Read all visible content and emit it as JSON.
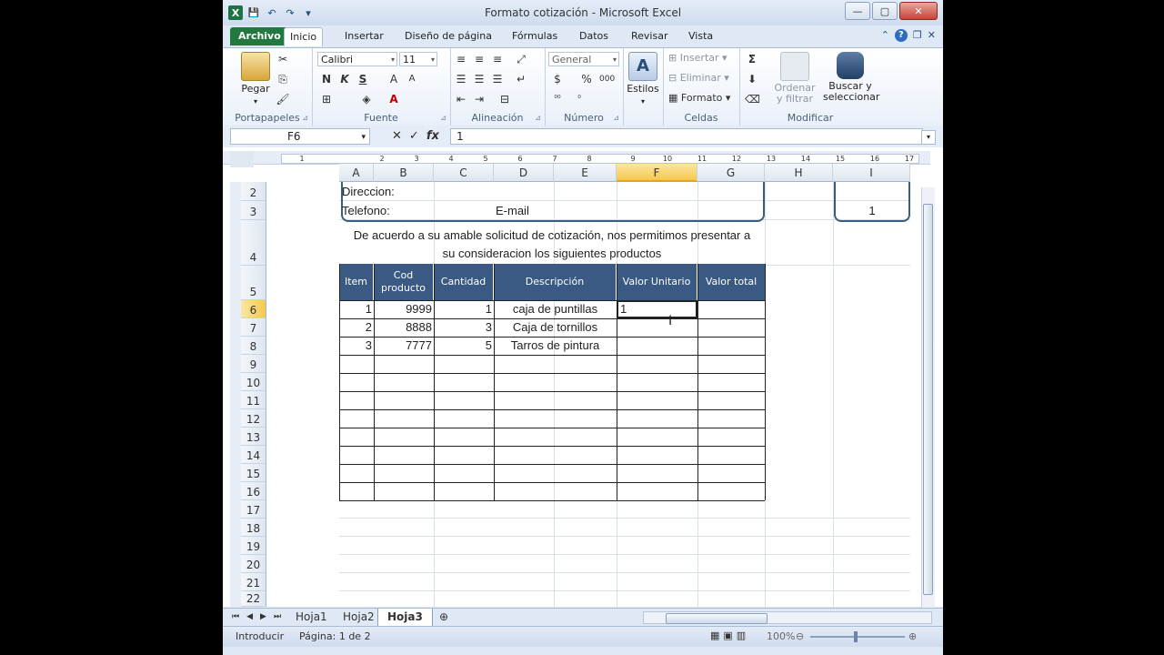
{
  "window": {
    "title": "Formato cotización  -  Microsoft Excel",
    "min": "—",
    "max": "▢",
    "close": "✕"
  },
  "qat": {
    "logo": "X",
    "save": "💾",
    "undo": "↶",
    "redo": "↷",
    "more": "▾"
  },
  "tabs": [
    "Archivo",
    "Inicio",
    "Insertar",
    "Diseño de página",
    "Fórmulas",
    "Datos",
    "Revisar",
    "Vista"
  ],
  "ribbon": {
    "portapapeles": {
      "paste": "Pegar",
      "label": "Portapapeles"
    },
    "fuente": {
      "font": "Calibri",
      "size": "11",
      "bold": "N",
      "italic": "K",
      "underline": "S",
      "grow": "A",
      "shrink": "A",
      "color": "A",
      "label": "Fuente"
    },
    "alineacion": {
      "label": "Alineación"
    },
    "numero": {
      "format": "General",
      "currency": "$",
      "percent": "%",
      "thousands": "000",
      "label": "Número"
    },
    "estilos": {
      "styles": "Estilos"
    },
    "celdas": {
      "insert": "Insertar",
      "delete": "Eliminar",
      "format": "Formato",
      "label": "Celdas"
    },
    "modificar": {
      "sum": "Σ",
      "sort": "Ordenar y filtrar",
      "find": "Buscar y seleccionar",
      "label": "Modificar"
    }
  },
  "formula_bar": {
    "name_box": "F6",
    "cancel": "✕",
    "enter": "✓",
    "fx": "fx",
    "value": "1"
  },
  "ruler": [
    "1",
    "2",
    "3",
    "4",
    "5",
    "6",
    "7",
    "8",
    "9",
    "10",
    "11",
    "12",
    "13",
    "14",
    "15",
    "16",
    "17"
  ],
  "columns": [
    "A",
    "B",
    "C",
    "D",
    "E",
    "F",
    "G",
    "H",
    "I"
  ],
  "rows": [
    "2",
    "3",
    "4",
    "5",
    "6",
    "7",
    "8",
    "9",
    "10",
    "11",
    "12",
    "13",
    "14",
    "15",
    "16",
    "17",
    "18",
    "19",
    "20",
    "21",
    "22"
  ],
  "sheet": {
    "direccion": "Direccion:",
    "telefono": "Telefono:",
    "email": "E-mail",
    "number_box": "1",
    "intro_line1": "De acuerdo a su amable solicitud de cotización, nos permitimos presentar a",
    "intro_line2": "su consideracion los siguientes productos",
    "headers": [
      "Item",
      "Cod producto",
      "Cantidad",
      "Descripción",
      "Valor Unitario",
      "Valor total"
    ],
    "items": [
      {
        "item": "1",
        "cod": "9999",
        "cant": "1",
        "desc": "caja de puntillas",
        "valor": "1"
      },
      {
        "item": "2",
        "cod": "8888",
        "cant": "3",
        "desc": "Caja de tornillos",
        "valor": ""
      },
      {
        "item": "3",
        "cod": "7777",
        "cant": "5",
        "desc": "Tarros de pintura",
        "valor": ""
      }
    ]
  },
  "sheet_tabs": [
    "Hoja1",
    "Hoja2",
    "Hoja3"
  ],
  "status": {
    "mode": "Introducir",
    "page": "Página: 1 de 2",
    "zoom": "100%"
  }
}
